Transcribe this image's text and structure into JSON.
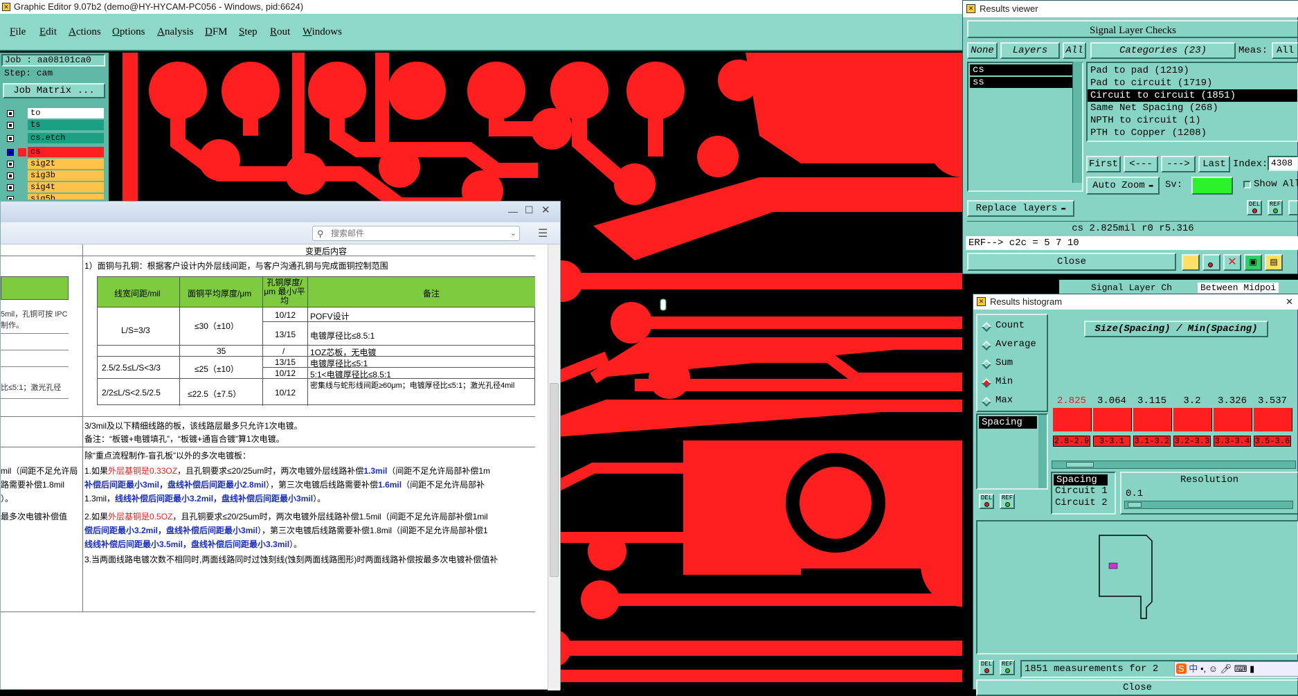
{
  "editor": {
    "title": "Graphic Editor 9.07b2 (demo@HY-HYCAM-PC056 - Windows, pid:6624)",
    "menus": [
      "File",
      "Edit",
      "Actions",
      "Options",
      "Analysis",
      "DFM",
      "Step",
      "Rout",
      "Windows"
    ],
    "job_label": "Job : aa08101ca0",
    "step_label": "Step: cam",
    "job_matrix_button": "Job Matrix ...",
    "layers": [
      {
        "name": "to",
        "color": "#ffffff"
      },
      {
        "name": "ts",
        "color": "#1aa184"
      },
      {
        "name": "cs.etch",
        "color": "#1aa184"
      },
      {
        "name": "cs",
        "color": "#ff1f1f"
      },
      {
        "name": "sig2t",
        "color": "#ffc34a"
      },
      {
        "name": "sig3b",
        "color": "#ffc34a"
      },
      {
        "name": "sig4t",
        "color": "#ffc34a"
      },
      {
        "name": "sig5b",
        "color": "#ffc34a"
      }
    ],
    "colors": {
      "copper": "#ff1f1f",
      "background": "#000000",
      "panel": "#87d4c5"
    }
  },
  "mail": {
    "search_placeholder": "搜索邮件",
    "column_header": "变更后内容",
    "intro": "1）面铜与孔铜：根据客户设计内外层线间距，与客户沟通孔铜与完成面铜控制范围",
    "table_headers": [
      "线宽间距/mil",
      "面铜平均厚度/μm",
      "孔铜厚度/μm 最小/平均",
      "备注"
    ],
    "table_rows": [
      {
        "a": "L/S=3/3",
        "b": "≤30（±10）",
        "c": "10/12",
        "d": "POFV设计"
      },
      {
        "a": "",
        "b": "",
        "c": "13/15",
        "d": "电镀厚径比≤8.5:1"
      },
      {
        "a": "",
        "b": "35",
        "c": "/",
        "d": "1OZ芯板，无电镀"
      },
      {
        "a": "2.5/2.5≤L/S<3/3",
        "b": "≤25（±10）",
        "c": "13/15",
        "d": "电镀厚径比≤5:1"
      },
      {
        "a": "",
        "b": "",
        "c": "10/12",
        "d": "5:1<电镀厚径比≤8.5:1"
      },
      {
        "a": "2/2≤L/S<2.5/2.5",
        "b": "≤22.5（±7.5）",
        "c": "10/12",
        "d": "密集线与蛇形线间距≥60μm；电镀厚径比≤5:1；激光孔径4mil"
      }
    ],
    "left_fragments": [
      "5mil，孔铜可按 IPC",
      "制作。",
      "比≤5:1；激光孔径",
      "mil（间距不足允许局",
      "路需要补偿1.8mil",
      "）。",
      "最多次电镀补偿值"
    ],
    "para1a": "3/3mil及以下精细线路的板，该线路层最多只允许1次电镀。",
    "para1b": "备注：“板镀+电镀填孔”，“板镀+通盲合镀”算1次电镀。",
    "para2_title": "除“重点流程制作-盲孔板”以外的多次电镀板：",
    "p2_l1_a": "1.如果",
    "p2_l1_red": "外层基铜是0.33OZ",
    "p2_l1_b": "，且孔铜要求≤20/25um时，两次电镀外层线路补偿",
    "p2_l1_blue": "1.3mil",
    "p2_l1_c": "（间距不足允许局部补偿1m",
    "p2_l2_blue1": "补偿后间距最小3mil，盘线补偿后间距最小2.8mil",
    "p2_l2_b": "），第三次电镀后线路需要补偿",
    "p2_l2_blue2": "1.6mil",
    "p2_l2_c": "（间距不足允许局部补",
    "p2_l3_a": "1.3mil，",
    "p2_l3_blue": "线线补偿后间距最小3.2mil，盘线补偿后间距最小3mil",
    "p2_l3_b": "）。",
    "p2_l4_a": "2.如果",
    "p2_l4_red": "外层基铜是0.5OZ",
    "p2_l4_b": "，且孔铜要求≤20/25um时，两次电镀外层线路补偿1.5mil（间距不足允许局部补偿1mil",
    "p2_l5_blue": "偿后间距最小3.2mil，盘线补偿后间距最小3mil",
    "p2_l5_b": "），第三次电镀后线路需要补偿1.8mil（间距不足允许局部补偿1",
    "p2_l6_blue": "线线补偿后间距最小3.5mil，盘线补偿后间距最小3.3mil",
    "p2_l6_b": "）。",
    "p2_l7": "3.当两面线路电镀次数不相同时,两面线路同时过蚀刻线(蚀刻两面线路图形)时两面线路补偿按最多次电镀补偿值补"
  },
  "results_viewer": {
    "title": "Results viewer",
    "header": "Signal Layer Checks",
    "none_btn": "None",
    "layers_btn": "Layers",
    "all_btn": "All",
    "categories_btn": "Categories (23)",
    "meas_label": "Meas:",
    "meas_value": "All",
    "layers": [
      "cs",
      "ss"
    ],
    "categories": [
      "Pad to pad (1219)",
      "Pad to circuit (1719)",
      "Circuit to circuit (1851)",
      "Same Net Spacing (268)",
      "NPTH to circuit (1)",
      "PTH to Copper (1208)"
    ],
    "selected_category": 2,
    "first_btn": "First",
    "prev_btn": "<---",
    "next_btn": "--->",
    "last_btn": "Last",
    "index_label": "Index:",
    "index_value": "4308",
    "auto_zoom": "Auto Zoom",
    "sv_label": "Sv:",
    "show_all": "Show All",
    "replace_layers": "Replace layers",
    "info_line": "cs 2.825mil  r0  r5.316",
    "erf_line": "ERF--> c2c = 5 7 10",
    "close_btn": "Close",
    "tab_signal": "Signal Layer Ch",
    "tab_between": "Between Midpoi"
  },
  "results_histogram": {
    "title": "Results histogram",
    "modes": [
      "Count",
      "Average",
      "Sum",
      "Min",
      "Max"
    ],
    "selected_mode": "Min",
    "hist_title": "Size(Spacing) / Min(Spacing)",
    "list_item": "Spacing",
    "chart_data": {
      "type": "bar",
      "categories": [
        "2.8-2.9",
        "3-3.1",
        "3.1-3.2",
        "3.2-3.3",
        "3.3-3.4",
        "3.5-3.6"
      ],
      "values": [
        2.825,
        3.064,
        3.115,
        3.2,
        3.326,
        3.537
      ],
      "value_labels": [
        "2.825",
        "3.064",
        "3.115",
        "3.2",
        "3.326",
        "3.537"
      ],
      "highlight_index": 0
    },
    "attr_list": [
      "Spacing",
      "Circuit 1",
      "Circuit 2"
    ],
    "resolution_label": "Resolution",
    "resolution_value": "0.1",
    "measurements": "1851 measurements for 2",
    "close_btn": "Close"
  }
}
